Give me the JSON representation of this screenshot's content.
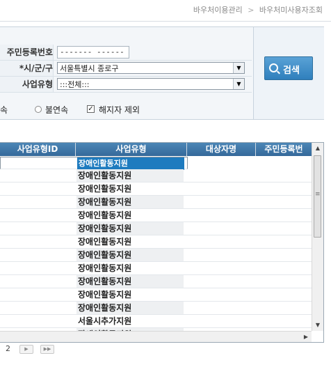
{
  "breadcrumb": {
    "item1": "바우처이용관리",
    "separator": ">",
    "item2": "바우처미사용자조회"
  },
  "form": {
    "ssn_label": "주민등록번호",
    "ssn_value": "------- --------",
    "region_label": "*시/군/구",
    "region_value": "서울특별시 종로구",
    "biztype_label": "사업유형",
    "biztype_value": ":::전체:::",
    "opt_partial": "속",
    "opt_noncontinuous": "불연속",
    "opt_exclude_cancelled": "해지자 제외",
    "exclude_cancelled_checked": true
  },
  "search_button": {
    "label": "검색",
    "icon": "magnifier-icon"
  },
  "grid": {
    "headers": [
      "사업유형ID",
      "사업유형",
      "대상자명",
      "주민등록번"
    ],
    "rows": [
      {
        "type": "장애인활동지원"
      },
      {
        "type": "장애인활동지원"
      },
      {
        "type": "장애인활동지원"
      },
      {
        "type": "장애인활동지원"
      },
      {
        "type": "장애인활동지원"
      },
      {
        "type": "장애인활동지원"
      },
      {
        "type": "장애인활동지원"
      },
      {
        "type": "장애인활동지원"
      },
      {
        "type": "장애인활동지원"
      },
      {
        "type": "장애인활동지원"
      },
      {
        "type": "장애인활동지원"
      },
      {
        "type": "장애인활동지원"
      },
      {
        "type": "서울시추가지원"
      },
      {
        "type": "장애인활동지원"
      }
    ],
    "selected_index": 0
  },
  "pager": {
    "page": "2"
  },
  "colors": {
    "accent": "#1e7bbf",
    "header": "#3b72a3"
  }
}
